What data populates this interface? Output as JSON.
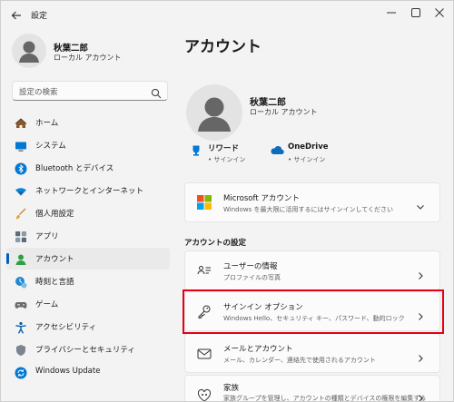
{
  "window": {
    "title": "設定"
  },
  "profile": {
    "name": "秋葉二郎",
    "account_type": "ローカル アカウント"
  },
  "search": {
    "placeholder": "設定の検索"
  },
  "sidebar": {
    "items": [
      {
        "label": "ホーム",
        "icon": "home-icon"
      },
      {
        "label": "システム",
        "icon": "system-icon"
      },
      {
        "label": "Bluetooth とデバイス",
        "icon": "bluetooth-icon"
      },
      {
        "label": "ネットワークとインターネット",
        "icon": "wifi-icon"
      },
      {
        "label": "個人用設定",
        "icon": "brush-icon"
      },
      {
        "label": "アプリ",
        "icon": "apps-icon"
      },
      {
        "label": "アカウント",
        "icon": "account-icon",
        "active": true
      },
      {
        "label": "時刻と言語",
        "icon": "time-language-icon"
      },
      {
        "label": "ゲーム",
        "icon": "gamepad-icon"
      },
      {
        "label": "アクセシビリティ",
        "icon": "accessibility-icon"
      },
      {
        "label": "プライバシーとセキュリティ",
        "icon": "shield-icon"
      },
      {
        "label": "Windows Update",
        "icon": "update-icon"
      }
    ]
  },
  "main": {
    "title": "アカウント",
    "user": {
      "name": "秋葉二郎",
      "account_type": "ローカル アカウント"
    },
    "services": [
      {
        "name": "リワード",
        "status": "• サインイン"
      },
      {
        "name": "OneDrive",
        "status": "• サインイン"
      }
    ],
    "microsoft_account": {
      "title": "Microsoft アカウント",
      "desc": "Windows を最大限に活用するにはサインインしてください"
    },
    "section_label": "アカウントの設定",
    "settings": [
      {
        "title": "ユーザーの情報",
        "desc": "プロファイルの写真"
      },
      {
        "title": "サインイン オプション",
        "desc": "Windows Hello、セキュリティ キー、パスワード、動的ロック"
      },
      {
        "title": "メールとアカウント",
        "desc": "メール、カレンダー、連絡先で使用されるアカウント"
      },
      {
        "title": "家族",
        "desc": "家族グループを管理し、アカウントの種類とデバイスの権限を編集する"
      }
    ]
  },
  "colors": {
    "accent": "#005fb8",
    "highlight": "#e60012",
    "background": "#f3f3f3"
  }
}
